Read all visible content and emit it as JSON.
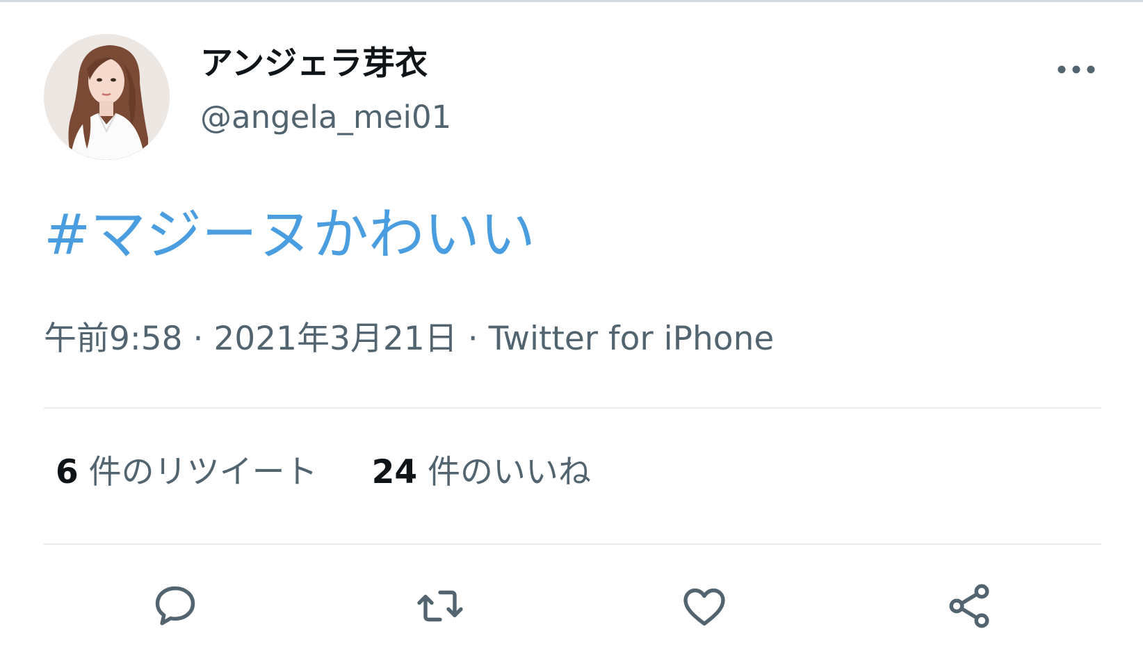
{
  "author": {
    "display_name": "アンジェラ芽衣",
    "handle": "@angela_mei01"
  },
  "tweet": {
    "text": "#マジーヌかわいい"
  },
  "meta": {
    "time": "午前9:58",
    "separator": "·",
    "date": "2021年3月21日",
    "source": "Twitter for iPhone"
  },
  "stats": {
    "retweets_count": "6",
    "retweets_label": "件のリツイート",
    "likes_count": "24",
    "likes_label": "件のいいね"
  },
  "icons": {
    "more": "more-horizontal-icon",
    "reply": "reply-bubble-icon",
    "retweet": "retweet-arrows-icon",
    "like": "heart-icon",
    "share": "share-icon"
  },
  "colors": {
    "hashtag": "#4a9ee0",
    "secondary_text": "#536471",
    "primary_text": "#0f1419",
    "divider": "#e6ecf0",
    "icon": "#536471"
  }
}
